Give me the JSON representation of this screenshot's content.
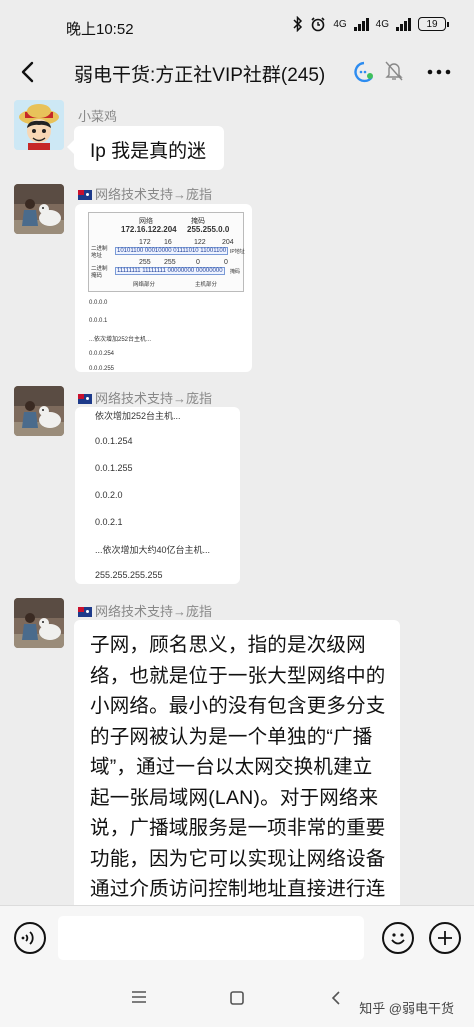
{
  "status_bar": {
    "time": "晚上10:52",
    "network_1": "4G",
    "network_2": "4G",
    "battery": "19"
  },
  "header": {
    "title": "弱电干货:方正社VIP社群(245)"
  },
  "messages": [
    {
      "sender": "小菜鸡",
      "text": "Ip 我是真的迷"
    },
    {
      "sender": "网络技术支持→庞指",
      "image": {
        "label_network": "网络",
        "label_mask": "掩码",
        "ip_dotted": "172.16.122.204",
        "mask_dotted": "255.255.0.0",
        "octets_ip": [
          "172",
          "16",
          "122",
          "204"
        ],
        "octets_mask": [
          "255",
          "255",
          "0",
          "0"
        ],
        "row_label_1": "二进制\n地址",
        "row_label_2": "二进制\n掩码",
        "bin_ip": "10101100 00010000 01111010 11001100",
        "bin_mask": "11111111 11111111 00000000 00000000",
        "side_1": "IP地址",
        "side_2": "掩码",
        "net_part": "网络部分",
        "host_part": "主机部分",
        "lines": [
          "0.0.0.0",
          "0.0.0.1",
          "...依次增加252台主机...",
          "0.0.0.254",
          "0.0.0.255"
        ]
      }
    },
    {
      "sender": "网络技术支持→庞指",
      "image": {
        "lines": [
          "依次增加252台主机...",
          "0.0.1.254",
          "0.0.1.255",
          "0.0.2.0",
          "0.0.2.1",
          "...依次增加大约40亿台主机...",
          "255.255.255.255"
        ]
      }
    },
    {
      "sender": "网络技术支持→庞指",
      "text": "子网，顾名思义，指的是次级网络，也就是位于一张大型网络中的小网络。最小的没有包含更多分支的子网被认为是一个单独的“广播域”，通过一台以太网交换机建立起一张局域网(LAN)。对于网络来说，广播域服务是一项非常的重要功能，因为它可以实现让网络设备通过介质访问控制地址直接进行连接，而不必经多张子网，甚至整个互联网"
    }
  ],
  "footer": {
    "watermark": "知乎 @弱电干货"
  },
  "icons": {
    "back": "chevron-left-icon",
    "group_badge": "group-chat-icon",
    "mute": "bell-off-icon",
    "more": "more-dots-icon",
    "voice": "voice-icon",
    "emoji": "emoji-icon",
    "add": "plus-icon"
  }
}
